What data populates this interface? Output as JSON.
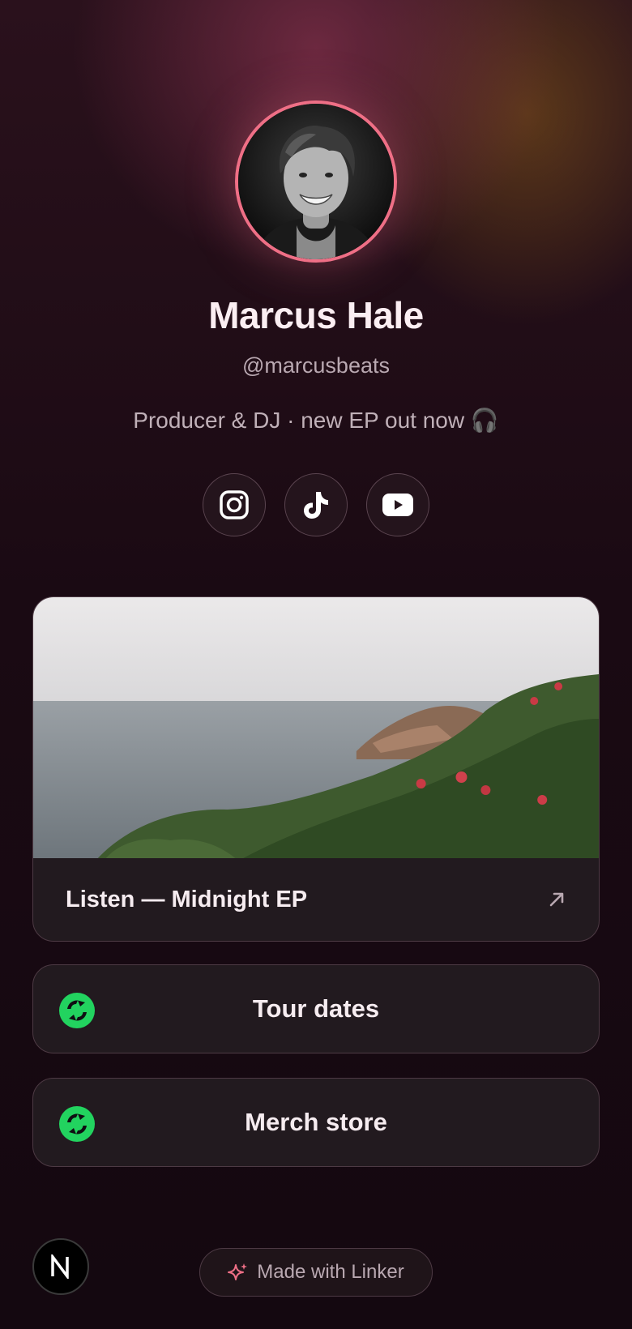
{
  "profile": {
    "name": "Marcus Hale",
    "handle": "@marcusbeats",
    "bio": "Producer & DJ · new EP out now 🎧"
  },
  "socials": [
    {
      "icon": "instagram-icon"
    },
    {
      "icon": "tiktok-icon"
    },
    {
      "icon": "youtube-icon"
    }
  ],
  "feature": {
    "label": "Listen — Midnight EP",
    "icon": "arrow-up-right-icon"
  },
  "links": [
    {
      "label": "Tour dates",
      "icon": "linker-refresh-icon"
    },
    {
      "label": "Merch store",
      "icon": "linker-refresh-icon"
    }
  ],
  "footer": {
    "made_with": "Made with Linker",
    "sparkle_icon": "sparkle-icon",
    "badge_letter": "N"
  },
  "colors": {
    "accent": "#ef6f86",
    "link_icon": "#22d35f",
    "card_bg": "#221a1f",
    "page_bg": "#180a12"
  }
}
